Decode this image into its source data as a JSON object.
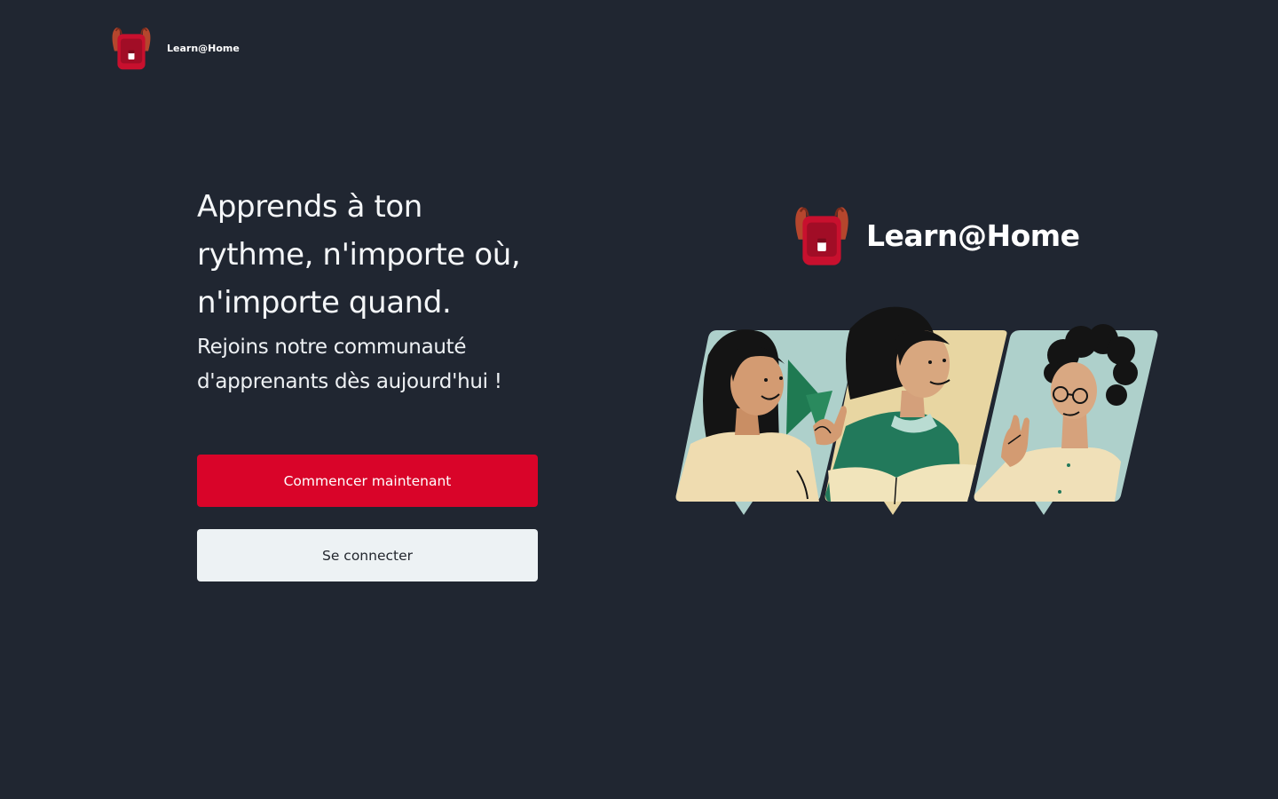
{
  "brand": {
    "name": "Learn@Home",
    "accent": "#d90429",
    "background": "#202631"
  },
  "hero": {
    "title_line1": "Apprends à ton",
    "title_line2": "rythme, n'importe où,",
    "title_line3": "n'importe quand.",
    "subtitle_line1": "Rejoins notre communauté",
    "subtitle_line2": "d'apprenants dès aujourd'hui !"
  },
  "actions": {
    "primary_label": "Commencer maintenant",
    "secondary_label": "Se connecter"
  },
  "icons": {
    "logo": "backpack-icon",
    "illustration": "learners-illustration"
  }
}
